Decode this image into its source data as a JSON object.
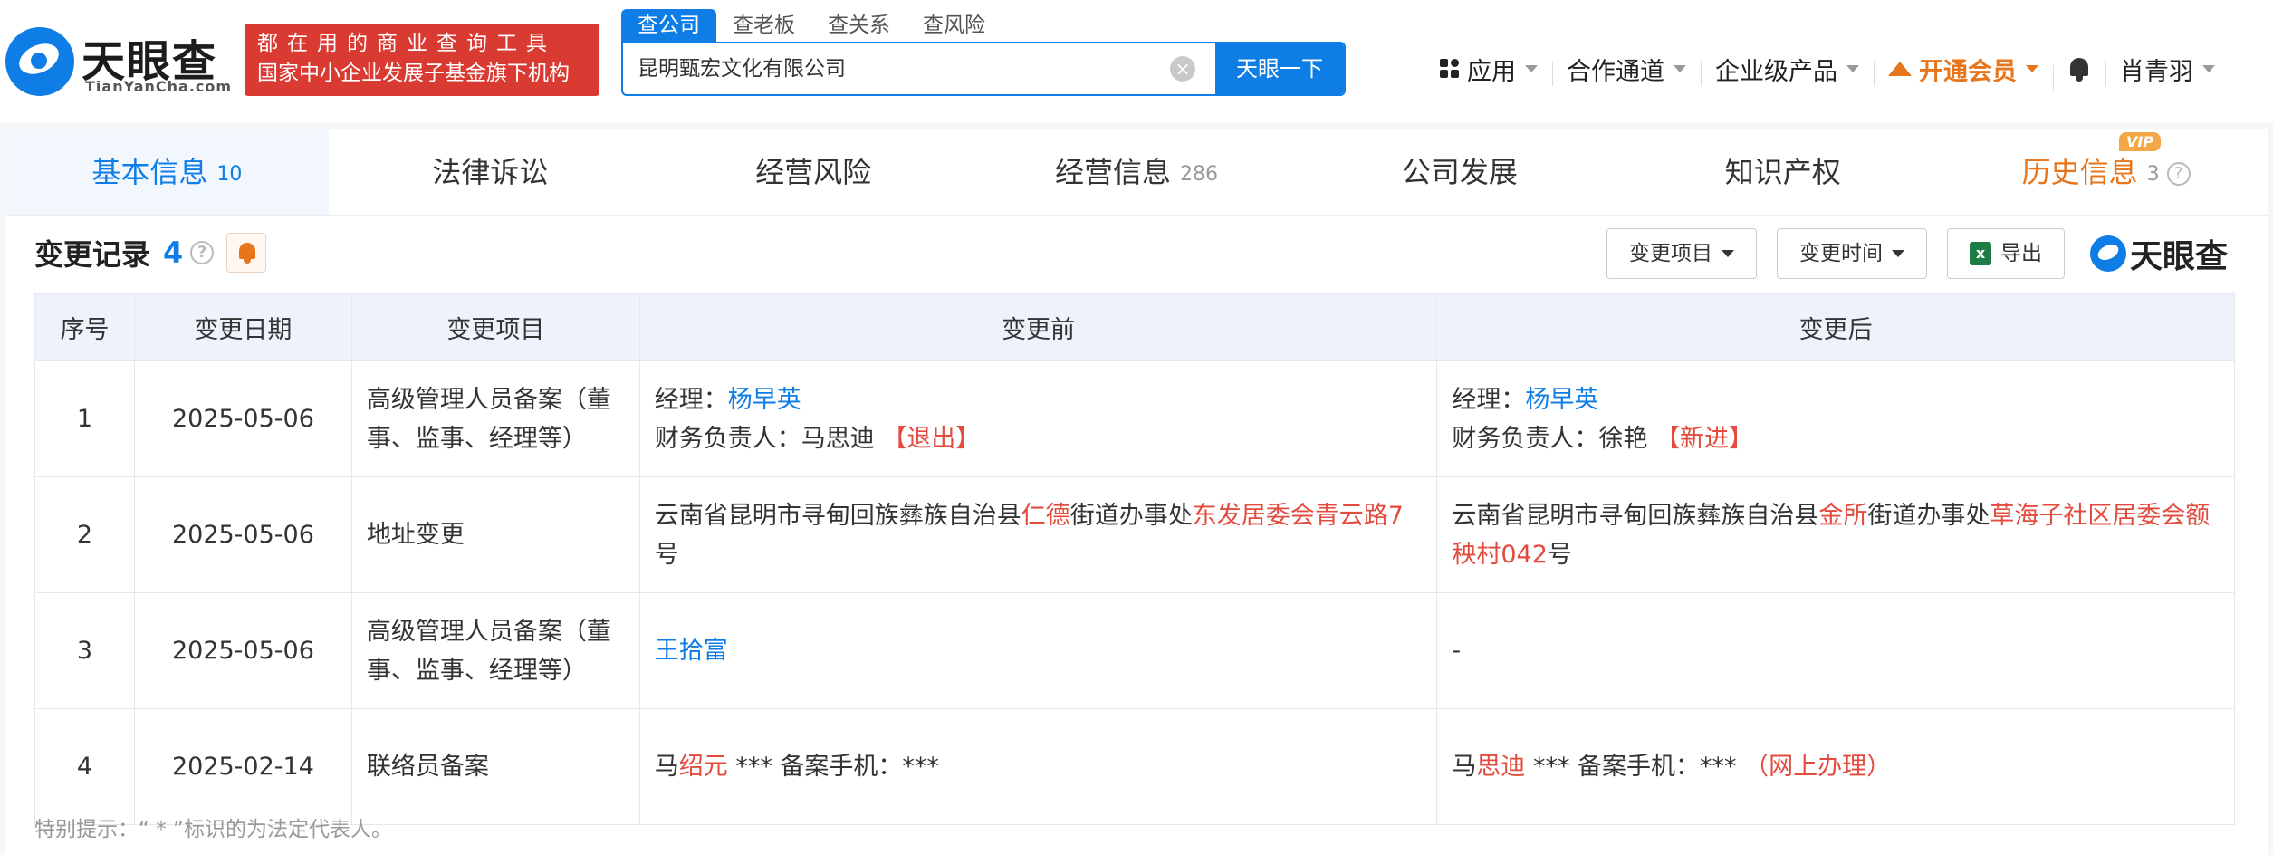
{
  "header": {
    "logo_cn": "天眼查",
    "logo_en": "TianYanCha.com",
    "slogan_line1": "都在用的商业查询工具",
    "slogan_line2": "国家中小企业发展子基金旗下机构",
    "search_tabs": [
      "查公司",
      "查老板",
      "查关系",
      "查风险"
    ],
    "search_value": "昆明甄宏文化有限公司",
    "search_button": "天眼一下",
    "nav": {
      "apps": "应用",
      "partner": "合作通道",
      "enterprise": "企业级产品",
      "vip": "开通会员",
      "user": "肖青羽"
    }
  },
  "tabs": [
    {
      "label": "基本信息",
      "count": "10"
    },
    {
      "label": "法律诉讼",
      "count": ""
    },
    {
      "label": "经营风险",
      "count": ""
    },
    {
      "label": "经营信息",
      "count": "286"
    },
    {
      "label": "公司发展",
      "count": ""
    },
    {
      "label": "知识产权",
      "count": ""
    },
    {
      "label": "历史信息",
      "count": "3"
    }
  ],
  "vip_tag": "VIP",
  "section": {
    "title": "变更记录",
    "count": "4",
    "help": "?",
    "filter_item": "变更项目",
    "filter_time": "变更时间",
    "export": "导出",
    "brand": "天眼查"
  },
  "table": {
    "headers": [
      "序号",
      "变更日期",
      "变更项目",
      "变更前",
      "变更后"
    ],
    "rows": [
      {
        "no": "1",
        "date": "2025-05-06",
        "item": "高级管理人员备案（董事、监事、经理等）",
        "before": {
          "l1_label": "经理：",
          "l1_name": "杨早英",
          "l2_label": "财务负责人：马思迪",
          "l2_tag": "【退出】"
        },
        "after": {
          "l1_label": "经理：",
          "l1_name": "杨早英",
          "l2_label": "财务负责人：徐艳",
          "l2_tag": "【新进】"
        }
      },
      {
        "no": "2",
        "date": "2025-05-06",
        "item": "地址变更",
        "before": {
          "p1": "云南省昆明市寻甸回族彝族自治县",
          "h1": "仁德",
          "p2": "街道办事处",
          "h2": "东发居委会青云路7",
          "p3": "号"
        },
        "after": {
          "p1": "云南省昆明市寻甸回族彝族自治县",
          "h1": "金所",
          "p2": "街道办事处",
          "h2": "草海子社区居委会额秧村042",
          "p3": "号"
        }
      },
      {
        "no": "3",
        "date": "2025-05-06",
        "item": "高级管理人员备案（董事、监事、经理等）",
        "before": {
          "name": "王拾富"
        },
        "after": {
          "text": "-"
        }
      },
      {
        "no": "4",
        "date": "2025-02-14",
        "item": "联络员备案",
        "before": {
          "p1": "马",
          "h1": "绍元",
          "p2": " *** 备案手机：***"
        },
        "after": {
          "p1": "马",
          "h1": "思迪",
          "p2": " *** 备案手机：***",
          "tag": "（网上办理）"
        }
      }
    ]
  },
  "note": "特别提示：“ * ”标识的为法定代表人。",
  "colors": {
    "brand_blue": "#0e7ee6",
    "slogan_red": "#d93a32",
    "vip_orange": "#e8751a",
    "highlight_red": "#e34b3f"
  }
}
